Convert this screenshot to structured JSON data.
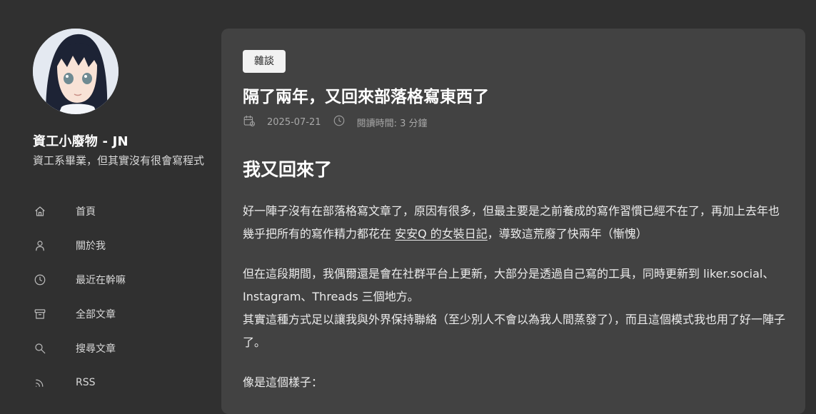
{
  "sidebar": {
    "site_title": "資工小廢物 - JN",
    "site_description": "資工系畢業，但其實沒有很會寫程式",
    "menu": [
      {
        "icon": "home-icon",
        "label": "首頁"
      },
      {
        "icon": "user-icon",
        "label": "關於我"
      },
      {
        "icon": "clock-icon",
        "label": "最近在幹嘛"
      },
      {
        "icon": "archive-icon",
        "label": "全部文章"
      },
      {
        "icon": "search-icon",
        "label": "搜尋文章"
      },
      {
        "icon": "rss-icon",
        "label": "RSS"
      }
    ]
  },
  "article": {
    "category": "雜談",
    "title": "隔了兩年，又回來部落格寫東西了",
    "date": "2025-07-21",
    "reading_time": "閱讀時間: 3 分鐘",
    "heading": "我又回來了",
    "p1_before": "好一陣子沒有在部落格寫文章了，原因有很多，但最主要是之前養成的寫作習慣已經不在了，再加上去年也幾乎把所有的寫作精力都花在 ",
    "p1_link": "安安Q 的女裝日記",
    "p1_after": "，導致這荒廢了快兩年（慚愧）",
    "p2_line1": "但在這段期間，我偶爾還是會在社群平台上更新，大部分是透過自己寫的工具，同時更新到 liker.social、Instagram、Threads 三個地方。",
    "p2_line2": "其實這種方式足以讓我與外界保持聯絡（至少別人不會以為我人間蒸發了），而且這個模式我也用了好一陣子了。",
    "p3": "像是這個樣子："
  }
}
